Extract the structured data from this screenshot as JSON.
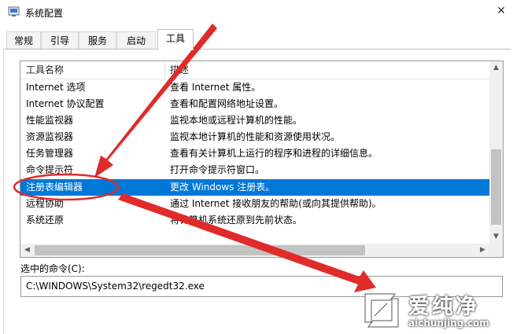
{
  "window": {
    "title": "系统配置",
    "close_glyph": "✕"
  },
  "tabs": [
    {
      "label": "常规",
      "active": false
    },
    {
      "label": "引导",
      "active": false
    },
    {
      "label": "服务",
      "active": false
    },
    {
      "label": "启动",
      "active": false
    },
    {
      "label": "工具",
      "active": true
    }
  ],
  "tools_list": {
    "headers": [
      "工具名称",
      "描述"
    ],
    "rows": [
      {
        "name": "Internet 选项",
        "desc": "查看 Internet 属性。",
        "selected": false
      },
      {
        "name": "Internet 协议配置",
        "desc": "查看和配置网络地址设置。",
        "selected": false
      },
      {
        "name": "性能监视器",
        "desc": "监视本地或远程计算机的性能。",
        "selected": false
      },
      {
        "name": "资源监视器",
        "desc": "监视本地计算机的性能和资源使用状况。",
        "selected": false
      },
      {
        "name": "任务管理器",
        "desc": "查看有关计算机上运行的程序和进程的详细信息。",
        "selected": false
      },
      {
        "name": "命令提示符",
        "desc": "打开命令提示符窗口。",
        "selected": false
      },
      {
        "name": "注册表编辑器",
        "desc": "更改 Windows 注册表。",
        "selected": true
      },
      {
        "name": "远程协助",
        "desc": "通过 Internet 接收朋友的帮助(或向其提供帮助)。",
        "selected": false
      },
      {
        "name": "系统还原",
        "desc": "将计算机系统还原到先前状态。",
        "selected": false
      }
    ]
  },
  "command": {
    "label": "选中的命令(C):",
    "value": "C:\\WINDOWS\\System32\\regedt32.exe"
  },
  "watermark": {
    "brand_cn": "爱纯净",
    "brand_url": "aichunjing.com"
  },
  "colors": {
    "selection": "#0078d7",
    "annotation_red": "#e02b2b"
  }
}
